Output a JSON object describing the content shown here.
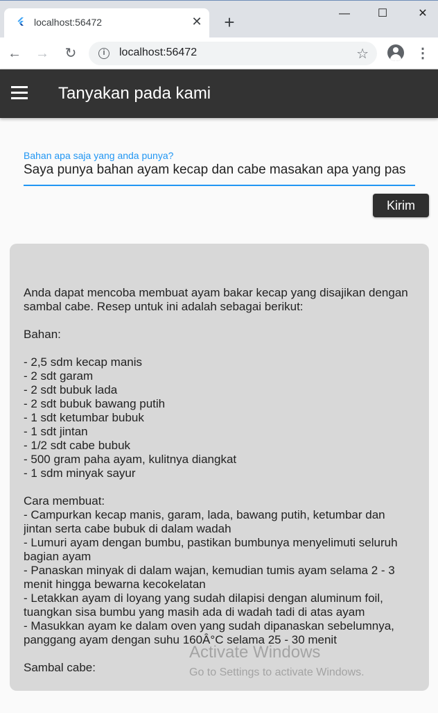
{
  "browser": {
    "tab_title": "localhost:56472",
    "url": "localhost:56472"
  },
  "app": {
    "title": "Tanyakan pada kami"
  },
  "input": {
    "label": "Bahan apa saja yang anda punya?",
    "value": "Saya punya bahan ayam kecap dan cabe masakan apa yang pas"
  },
  "send_button": "Kirim",
  "response": "Anda dapat mencoba membuat ayam bakar kecap yang disajikan dengan sambal cabe. Resep untuk ini adalah sebagai berikut:\n\nBahan:\n\n- 2,5 sdm kecap manis\n- 2 sdt garam\n- 2 sdt bubuk lada\n- 2 sdt bubuk bawang putih\n- 1 sdt ketumbar bubuk\n- 1 sdt jintan\n- 1/2 sdt cabe bubuk\n- 500 gram paha ayam, kulitnya diangkat\n- 1 sdm minyak sayur\n\nCara membuat:\n- Campurkan kecap manis, garam, lada, bawang putih, ketumbar dan jintan serta cabe bubuk di dalam wadah\n- Lumuri ayam dengan bumbu, pastikan bumbunya menyelimuti seluruh bagian ayam\n- Panaskan minyak di dalam wajan, kemudian tumis ayam selama 2 - 3 menit hingga bewarna kecokelatan\n- Letakkan ayam di loyang yang sudah dilapisi dengan aluminum foil, tuangkan sisa bumbu yang masih ada di wadah tadi di atas ayam\n- Masukkan ayam ke dalam oven yang sudah dipanaskan sebelumnya, panggang ayam dengan suhu 160Â°C selama 25 - 30 menit\n\nSambal cabe:",
  "watermark": {
    "title": "Activate Windows",
    "subtitle": "Go to Settings to activate Windows."
  },
  "colors": {
    "accent": "#2196f3",
    "appbar": "#333333",
    "card": "#d8d8d8"
  }
}
